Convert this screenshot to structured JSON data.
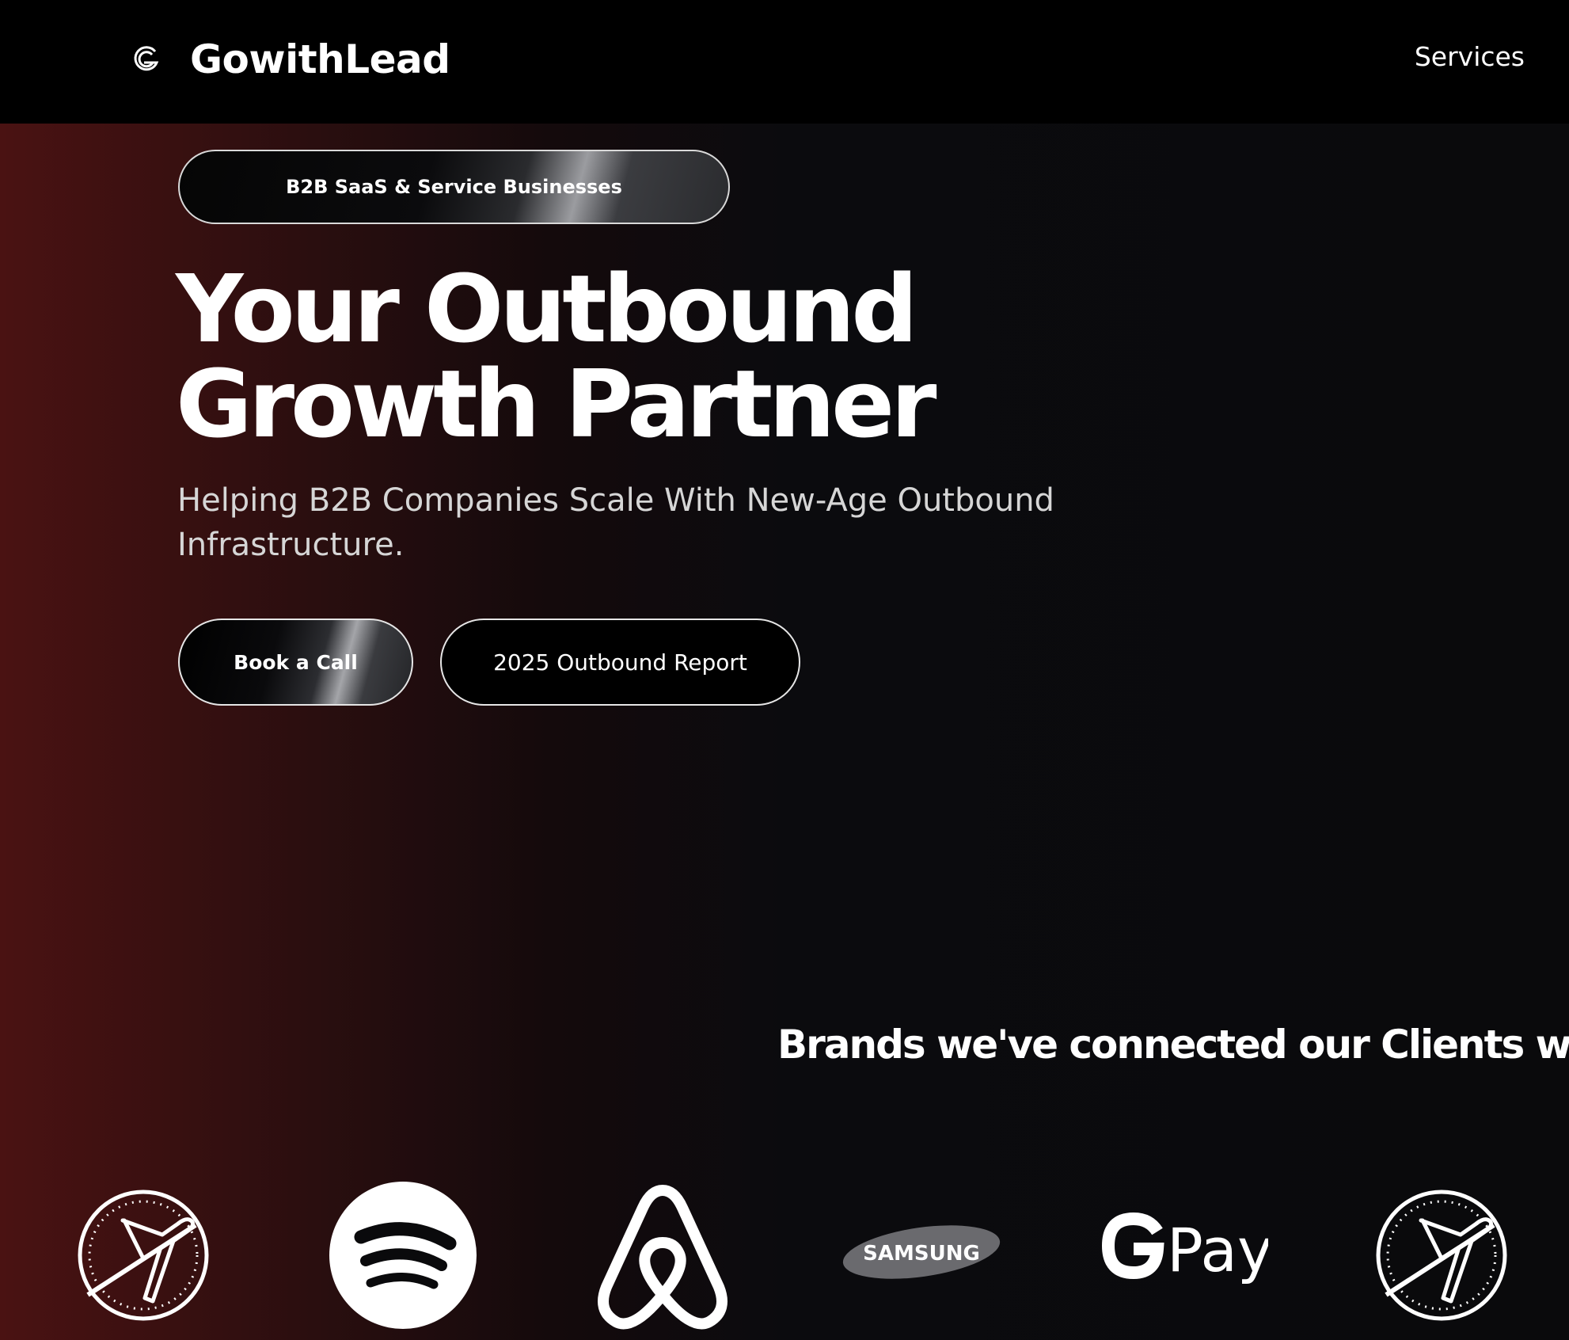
{
  "header": {
    "brand_name": "GowithLead",
    "nav_services": "Services"
  },
  "hero": {
    "tagline": "B2B SaaS & Service Businesses",
    "headline_line1": "Your Outbound",
    "headline_line2": "Growth Partner",
    "subheadline": "Helping B2B Companies Scale With New-Age Outbound Infrastructure.",
    "cta_primary": "Book a Call",
    "cta_secondary": "2025 Outbound Report"
  },
  "brands": {
    "title": "Brands we've connected our Clients with",
    "logos": [
      {
        "name": "plane-badge-icon"
      },
      {
        "name": "spotify-icon"
      },
      {
        "name": "airbnb-icon"
      },
      {
        "name": "samsung-icon",
        "text": "SAMSUNG"
      },
      {
        "name": "gpay-icon",
        "text": "Pay"
      },
      {
        "name": "plane-badge-icon"
      }
    ]
  },
  "colors": {
    "background": "#0a0a0c",
    "accent_red": "#4a1212",
    "text": "#ffffff",
    "subtext": "#d6d6d6"
  }
}
